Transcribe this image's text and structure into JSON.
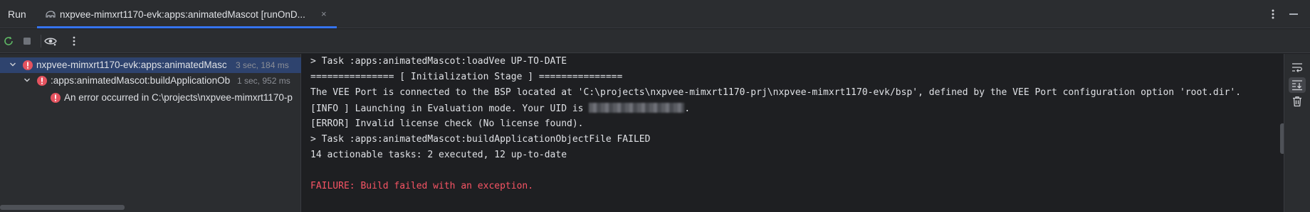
{
  "header": {
    "panel_title": "Run",
    "tab_label": "nxpvee-mimxrt1170-evk:apps:animatedMascot [runOnD...",
    "tab_close_glyph": "×",
    "tab_icon": "gradle-elephant-icon",
    "accent_color": "#3574f0"
  },
  "toolbar": {
    "buttons": [
      "rerun-icon",
      "stop-icon",
      "eye-icon",
      "more-vertical-icon"
    ]
  },
  "tree": {
    "items": [
      {
        "label": "nxpvee-mimxrt1170-evk:apps:animatedMasc",
        "meta": "3 sec, 184 ms",
        "status": "error",
        "selected": true
      },
      {
        "label": ":apps:animatedMascot:buildApplicationOb",
        "meta": "1 sec, 952 ms",
        "status": "error"
      },
      {
        "label": "An error occurred in C:\\projects\\nxpvee-mimxrt1170-p",
        "meta": "",
        "status": "error"
      }
    ]
  },
  "console": {
    "lines": [
      "> Task :apps:animatedMascot:loadVee UP-TO-DATE",
      "=============== [ Initialization Stage ] ===============",
      "The VEE Port is connected to the BSP located at 'C:\\projects\\nxpvee-mimxrt1170-prj\\nxpvee-mimxrt1170-evk/bsp', defined by the VEE Port configuration option 'root.dir'.",
      "[INFO ] Launching in Evaluation mode. Your UID is ",
      ".",
      "[ERROR] Invalid license check (No license found).",
      "> Task :apps:animatedMascot:buildApplicationObjectFile FAILED",
      "14 actionable tasks: 2 executed, 12 up-to-date",
      "",
      "FAILURE: Build failed with an exception."
    ],
    "error_color": "#f75464"
  },
  "gutter": {
    "buttons": [
      "soft-wrap-icon",
      "scroll-to-end-icon",
      "trash-icon"
    ]
  }
}
